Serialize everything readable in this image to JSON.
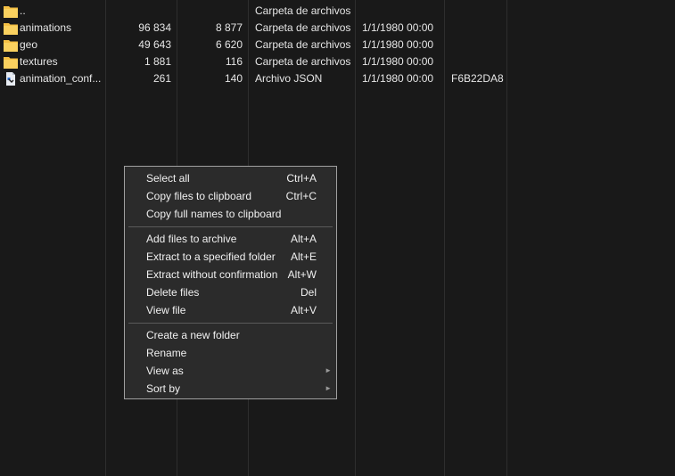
{
  "files": [
    {
      "name": "..",
      "size": "",
      "packed": "",
      "type": "Carpeta de archivos",
      "date": "",
      "crc": "",
      "icon": "folder-icon"
    },
    {
      "name": "animations",
      "size": "96 834",
      "packed": "8 877",
      "type": "Carpeta de archivos",
      "date": "1/1/1980 00:00",
      "crc": "",
      "icon": "folder-icon"
    },
    {
      "name": "geo",
      "size": "49 643",
      "packed": "6 620",
      "type": "Carpeta de archivos",
      "date": "1/1/1980 00:00",
      "crc": "",
      "icon": "folder-icon"
    },
    {
      "name": "textures",
      "size": "1 881",
      "packed": "116",
      "type": "Carpeta de archivos",
      "date": "1/1/1980 00:00",
      "crc": "",
      "icon": "folder-icon"
    },
    {
      "name": "animation_conf...",
      "size": "261",
      "packed": "140",
      "type": "Archivo JSON",
      "date": "1/1/1980 00:00",
      "crc": "F6B22DA8",
      "icon": "json-file-icon"
    }
  ],
  "context_menu": {
    "items": [
      {
        "label": "Select all",
        "shortcut": "Ctrl+A"
      },
      {
        "label": "Copy files to clipboard",
        "shortcut": "Ctrl+C"
      },
      {
        "label": "Copy full names to clipboard",
        "shortcut": ""
      },
      {
        "label": "Add files to archive",
        "shortcut": "Alt+A"
      },
      {
        "label": "Extract to a specified folder",
        "shortcut": "Alt+E"
      },
      {
        "label": "Extract without confirmation",
        "shortcut": "Alt+W"
      },
      {
        "label": "Delete files",
        "shortcut": "Del"
      },
      {
        "label": "View file",
        "shortcut": "Alt+V"
      },
      {
        "label": "Create a new folder",
        "shortcut": ""
      },
      {
        "label": "Rename",
        "shortcut": ""
      },
      {
        "label": "View as",
        "shortcut": "",
        "submenu": true
      },
      {
        "label": "Sort by",
        "shortcut": "",
        "submenu": true
      }
    ]
  },
  "colors": {
    "background": "#191919",
    "folder": "#f5c044",
    "text": "#e6e6e6",
    "menu_background": "#2b2b2b",
    "menu_border": "#a0a0a0"
  }
}
